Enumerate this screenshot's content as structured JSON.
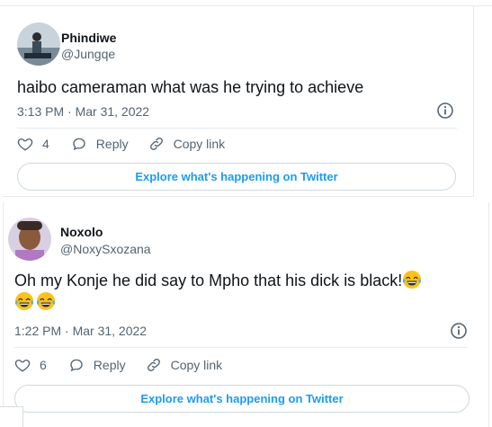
{
  "tweets": [
    {
      "name": "Phindiwe",
      "handle": "@Jungqe",
      "text": "haibo cameraman what was he trying to achieve",
      "timestamp": "3:13 PM · Mar 31, 2022",
      "likes": "4",
      "reply_label": "Reply",
      "copy_label": "Copy link",
      "explore_label": "Explore what's happening on Twitter"
    },
    {
      "name": "Noxolo",
      "handle": "@NoxySxozana",
      "text": "Oh my Konje he did say to Mpho that his dick is black!",
      "emojis": [
        "face-with-tears-of-joy",
        "face-with-tears-of-joy",
        "face-with-tears-of-joy"
      ],
      "timestamp": "1:22 PM · Mar 31, 2022",
      "likes": "6",
      "reply_label": "Reply",
      "copy_label": "Copy link",
      "explore_label": "Explore what's happening on Twitter"
    }
  ],
  "colors": {
    "accent": "#1d9bf0",
    "text": "#0f1419",
    "secondary": "#536471",
    "border": "#cfd9de"
  }
}
